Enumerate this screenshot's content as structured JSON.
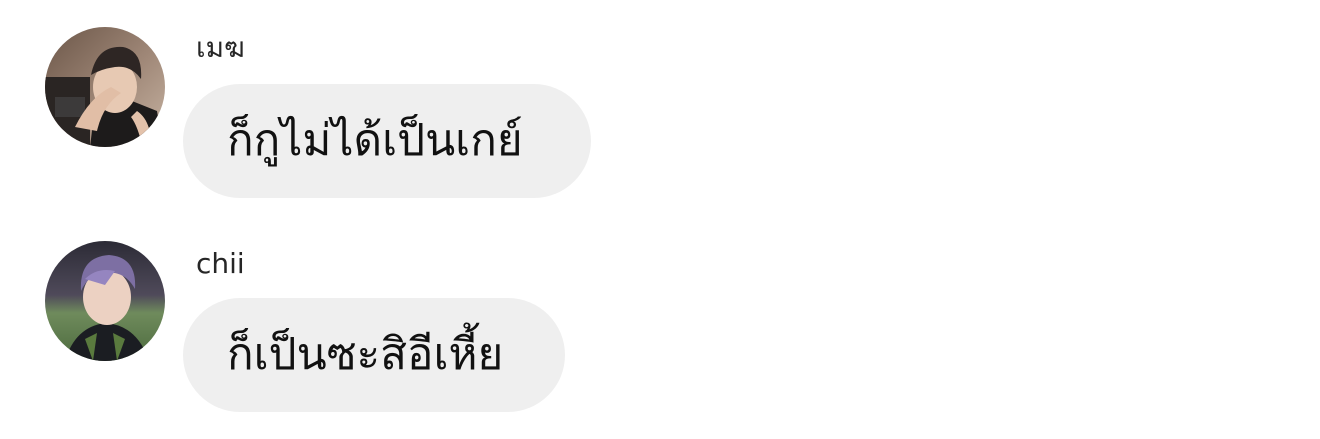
{
  "messages": [
    {
      "sender": "เมฆ",
      "text": "ก็กูไม่ได้เป็นเกย์",
      "avatar": "profile-photo-dim-room"
    },
    {
      "sender": "chii",
      "text": "ก็เป็นซะสิอีเหี้ย",
      "avatar": "profile-photo-selfie-field"
    }
  ],
  "colors": {
    "background": "#ffffff",
    "bubble": "#efefef",
    "text": "#111111",
    "sender_name": "#262626"
  }
}
